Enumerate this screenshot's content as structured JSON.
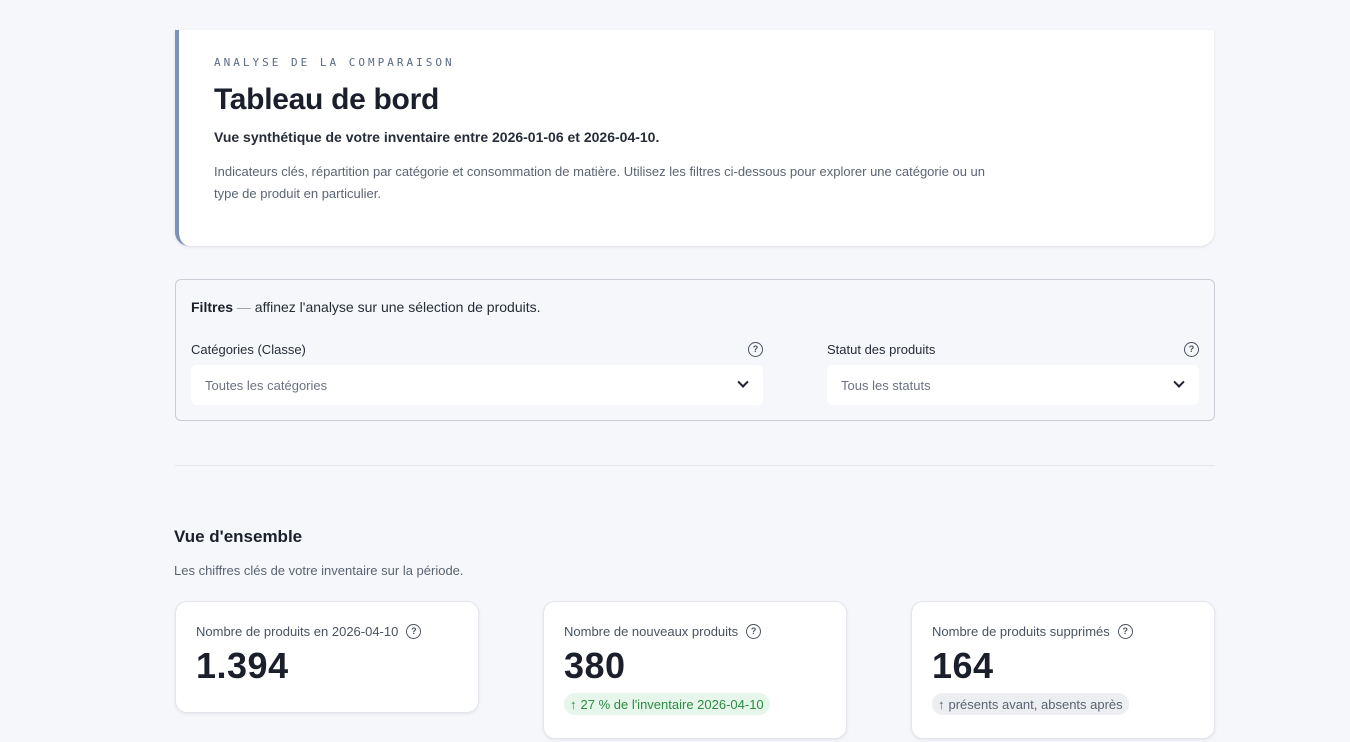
{
  "header": {
    "eyebrow": "ANALYSE DE LA COMPARAISON",
    "title": "Tableau de bord",
    "subtitle": "Vue synthétique de votre inventaire entre 2026-01-06 et 2026-04-10.",
    "description": "Indicateurs clés, répartition par catégorie et consommation de matière. Utilisez les filtres ci-dessous pour explorer une catégorie ou un type de produit en particulier."
  },
  "filters": {
    "title": "Filtres",
    "separator": "—",
    "hint": "affinez l'analyse sur une sélection de produits.",
    "category": {
      "label": "Catégories (Classe)",
      "selected": "Toutes les catégories",
      "icon": "help-icon"
    },
    "status": {
      "label": "Statut des produits",
      "selected": "Tous les statuts",
      "icon": "help-icon"
    }
  },
  "overview": {
    "title": "Vue d'ensemble",
    "subtitle": "Les chiffres clés de votre inventaire sur la période.",
    "kpis": [
      {
        "label": "Nombre de produits en 2026-04-10",
        "value": "1.394"
      },
      {
        "label": "Nombre de nouveaux produits",
        "value": "380",
        "delta": "27 % de l'inventaire 2026-04-10",
        "delta_color": "#2c8a44"
      },
      {
        "label": "Nombre de produits supprimés",
        "value": "164",
        "delta": "présents avant, absents après",
        "delta_color": "#5b6472"
      }
    ]
  },
  "colors": {
    "accent_border": "#7b93b8",
    "background": "#f5f7fa",
    "positive_badge": "#e6f6ea",
    "neutral_badge": "#eceef1"
  }
}
